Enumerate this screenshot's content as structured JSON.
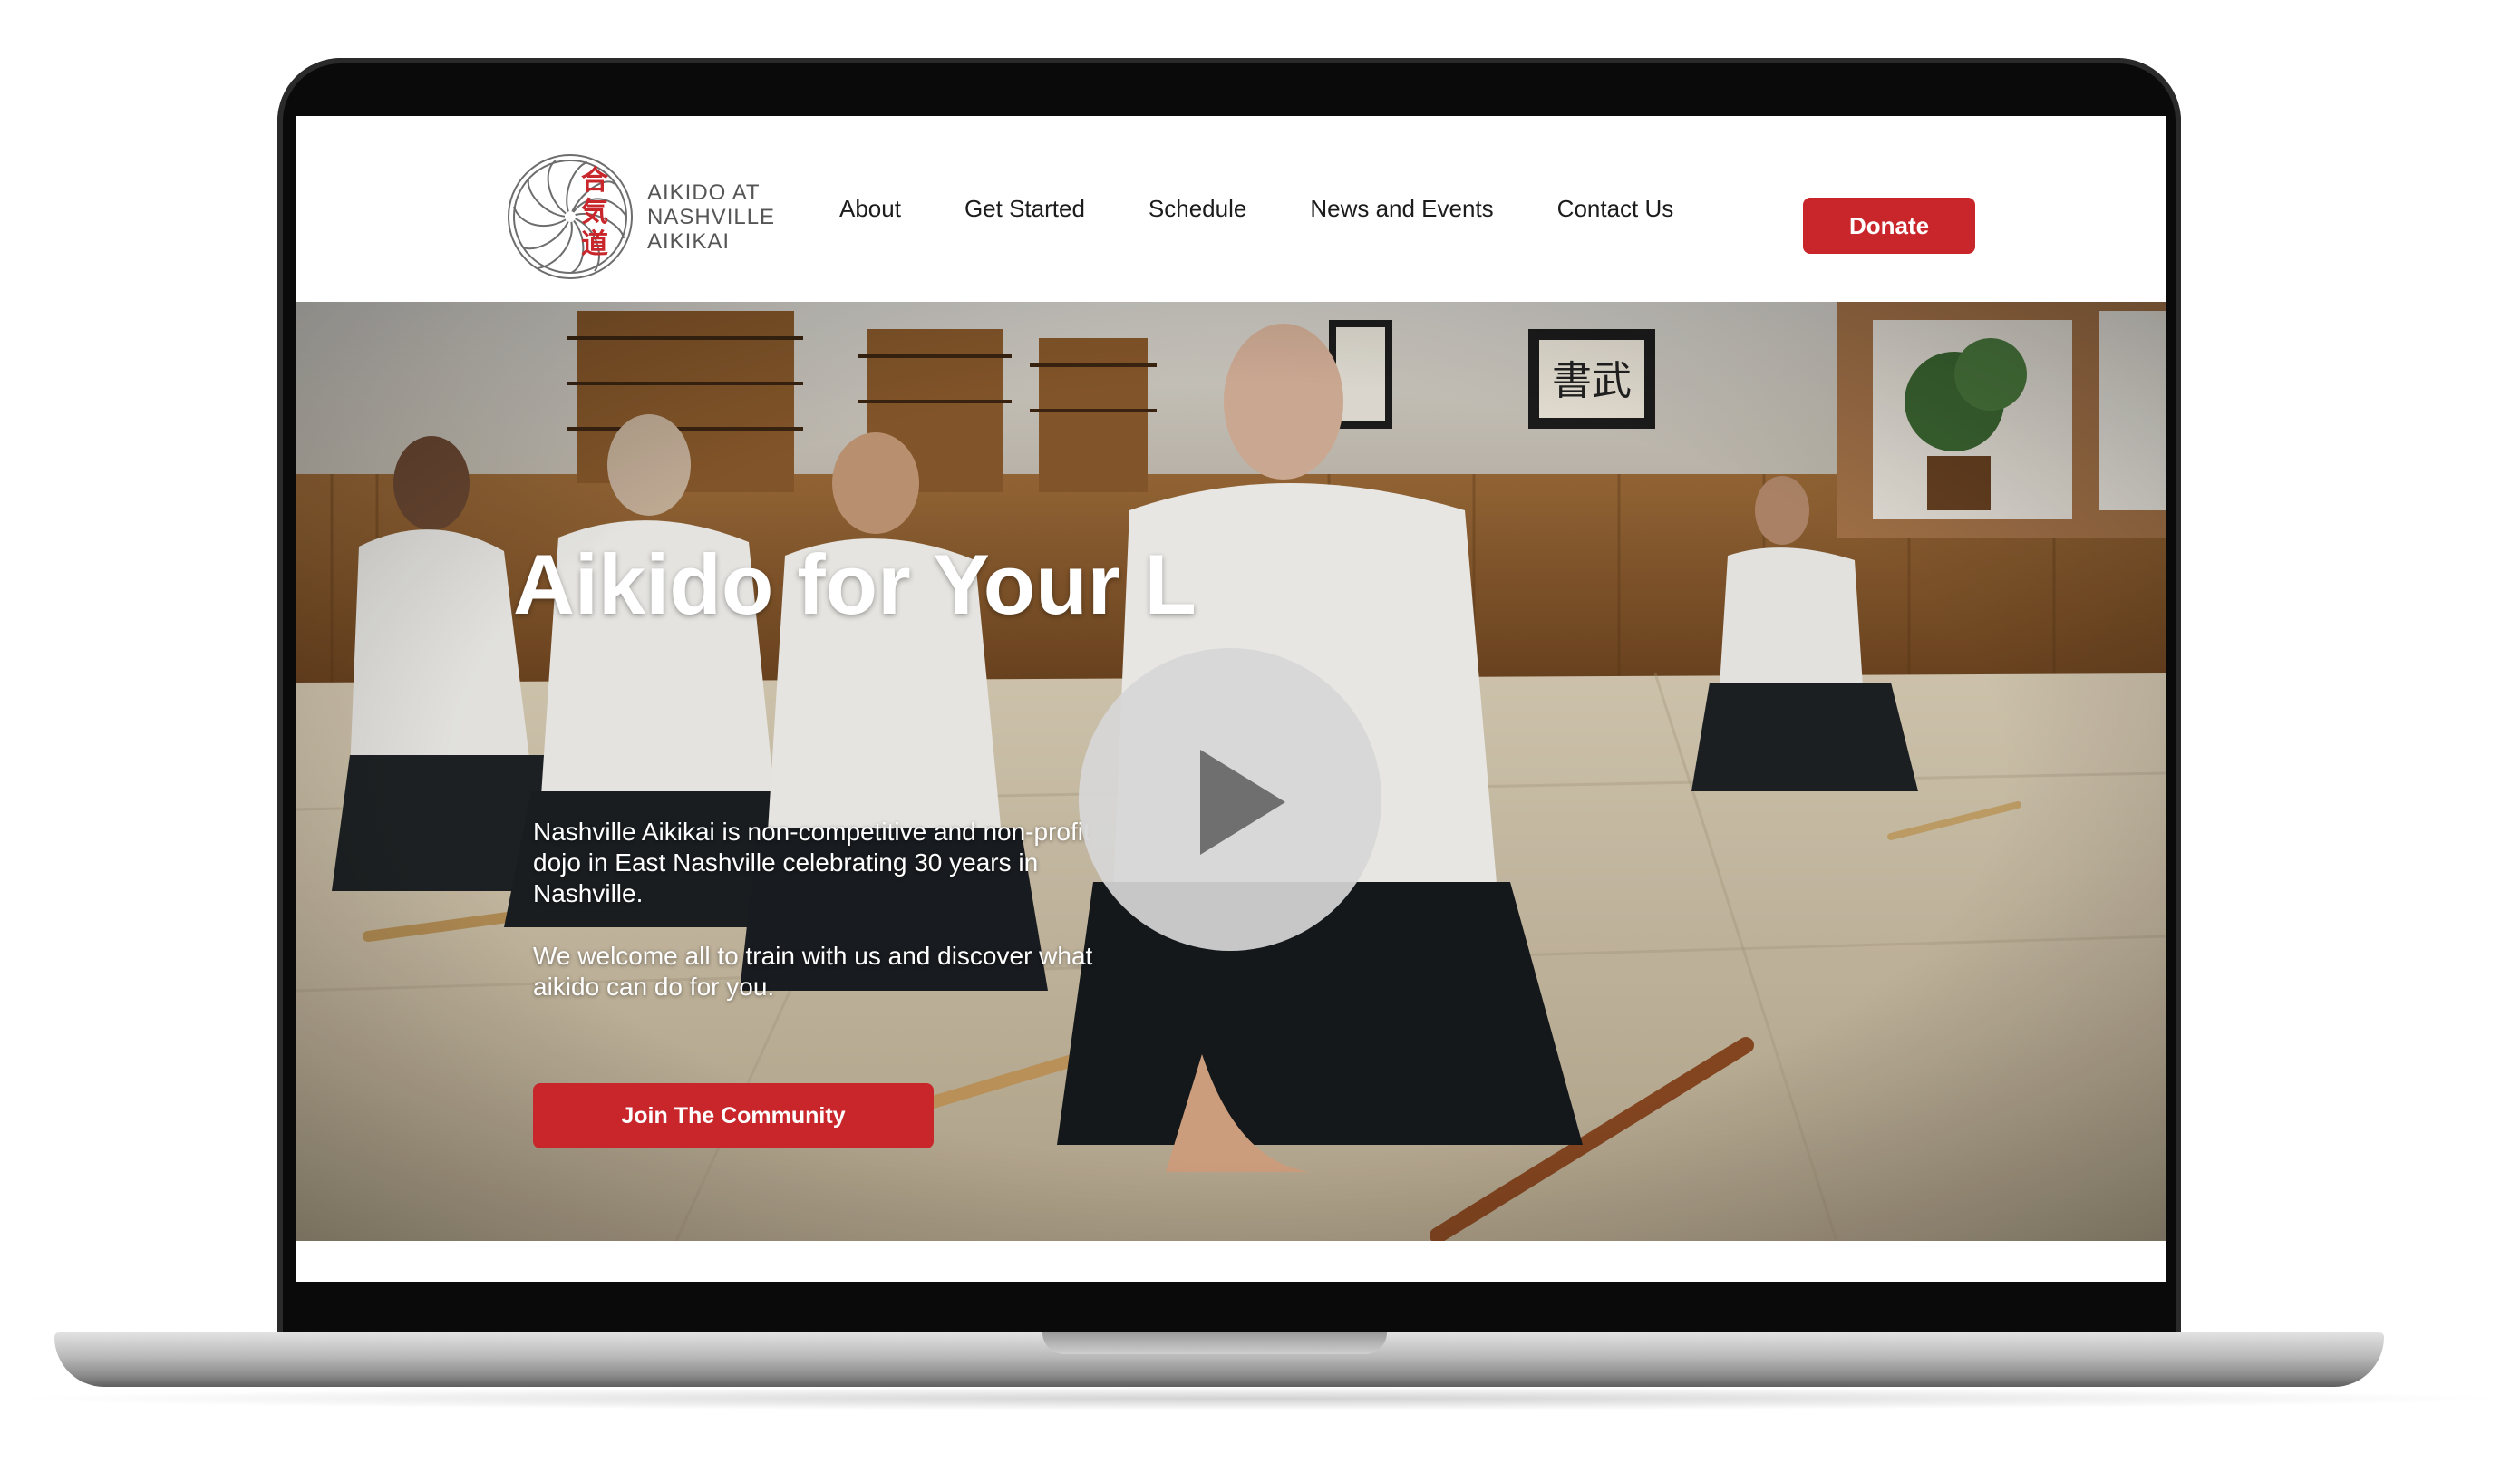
{
  "logo": {
    "kanji": [
      "合",
      "気",
      "道"
    ],
    "text_lines": [
      "AIKIDO AT",
      "NASHVILLE",
      "AIKIKAI"
    ]
  },
  "nav": {
    "items": [
      {
        "label": "About"
      },
      {
        "label": "Get Started"
      },
      {
        "label": "Schedule"
      },
      {
        "label": "News and Events"
      },
      {
        "label": "Contact Us"
      }
    ],
    "donate_label": "Donate"
  },
  "hero": {
    "title": "Aikido for Your L",
    "paragraph_1": "Nashville Aikikai is non-competitive and non-profit dojo in East Nashville celebrating 30 years in Nashville.",
    "paragraph_2": "We welcome all to train with us and discover what aikido can do for you.",
    "cta_label": "Join The Community",
    "wall_scroll_text": "書武"
  },
  "icons": {
    "play": "play-icon",
    "logo_mark": "spiral-logo-icon"
  },
  "colors": {
    "accent": "#c8262b",
    "text_dark": "#1c1c1c",
    "hero_text": "#ffffff"
  }
}
